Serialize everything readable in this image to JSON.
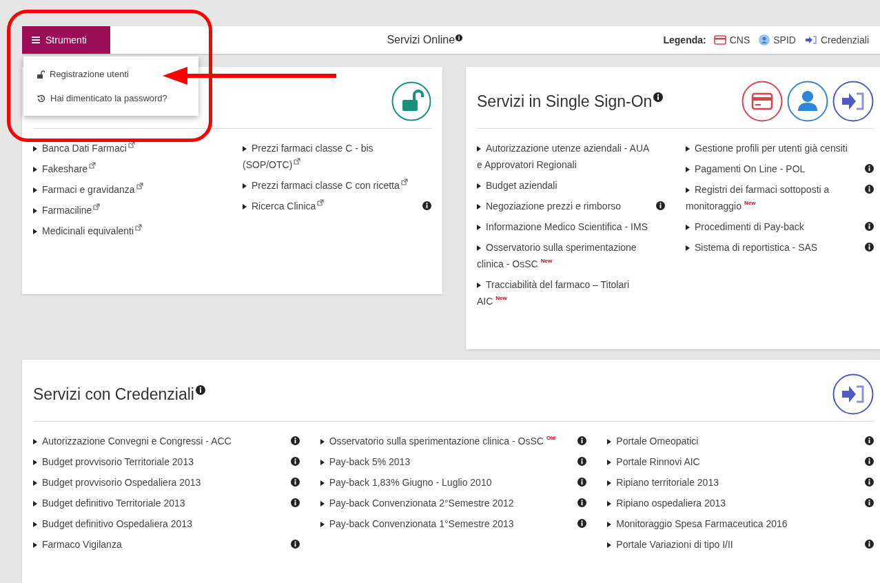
{
  "toolbar": {
    "menu_button": {
      "label": "Strumenti",
      "expanded": true
    },
    "title": "Servizi Online",
    "title_info": true,
    "legend": {
      "label": "Legenda:",
      "items": [
        {
          "kind": "cns",
          "label": "CNS"
        },
        {
          "kind": "spid",
          "label": "SPID"
        },
        {
          "kind": "credentials",
          "label": "Credenziali"
        }
      ]
    }
  },
  "menu": [
    {
      "kind": "lock",
      "label": "Registrazione utenti"
    },
    {
      "kind": "history",
      "label": "Hai dimenticato la password?"
    }
  ],
  "panels": [
    {
      "access": [
        {
          "kind": "open"
        }
      ],
      "columns": [
        [
          {
            "text": "Banca Dati Farmaci",
            "external": true,
            "info": false
          },
          {
            "text": "Fakeshare",
            "external": true,
            "info": false
          },
          {
            "text": "Farmaci e gravidanza",
            "external": true,
            "info": false
          },
          {
            "text": "Farmaciline",
            "external": true,
            "info": false
          },
          {
            "text": "Medicinali equivalenti",
            "external": true,
            "info": false
          }
        ],
        [
          {
            "text": "Prezzi farmaci classe C - bis (SOP/OTC)",
            "external": true,
            "info": false
          },
          {
            "text": "Prezzi farmaci classe C con ricetta",
            "external": true,
            "info": false
          },
          {
            "text": "Ricerca Clinica",
            "external": true,
            "info": true
          }
        ]
      ]
    },
    {
      "title": "Servizi in Single Sign-On",
      "title_info": true,
      "access": [
        {
          "kind": "cns"
        },
        {
          "kind": "spid"
        },
        {
          "kind": "credentials"
        }
      ],
      "columns": [
        [
          {
            "text": "Autorizzazione utenze aziendali - AUA e Approvatori Regionali",
            "info": false
          },
          {
            "text": "Budget aziendali",
            "info": false
          },
          {
            "text": "Negoziazione prezzi e rimborso",
            "info": true
          },
          {
            "text": "Informazione Medico Scientifica - IMS",
            "info": false
          },
          {
            "text": "Osservatorio sulla sperimentazione clinica - OsSC",
            "info": false,
            "badge": "New"
          },
          {
            "text": "Tracciabilità del farmaco – Titolari AIC",
            "info": false,
            "badge": "New"
          }
        ],
        [
          {
            "text": "Gestione profili per utenti già censiti",
            "info": false
          },
          {
            "text": "Pagamenti On Line - POL",
            "info": true
          },
          {
            "text": "Registri dei farmaci sottoposti a monitoraggio",
            "info": true,
            "badge": "New"
          },
          {
            "text": "Procedimenti di Pay-back",
            "info": true
          },
          {
            "text": "Sistema di reportistica - SAS",
            "info": true
          }
        ]
      ]
    },
    {
      "title": "Servizi con Credenziali",
      "title_info": true,
      "access": [
        {
          "kind": "credentials"
        }
      ],
      "columns": [
        [
          {
            "text": "Autorizzazione Convegni e Congressi - ACC",
            "info": true
          },
          {
            "text": "Budget provvisorio Territoriale 2013",
            "info": true
          },
          {
            "text": "Budget provvisorio Ospedaliera 2013",
            "info": true
          },
          {
            "text": "Budget definitivo Territoriale 2013",
            "info": true
          },
          {
            "text": "Budget definitivo Ospedaliera 2013",
            "info": false
          },
          {
            "text": "Farmaco Vigilanza",
            "info": true
          }
        ],
        [
          {
            "text": "Osservatorio sulla sperimentazione clinica - OsSC",
            "info": true,
            "badge": "Old"
          },
          {
            "text": "Pay-back 5% 2013",
            "info": true
          },
          {
            "text": "Pay-back 1,83% Giugno - Luglio 2010",
            "info": true
          },
          {
            "text": "Pay-back Convenzionata 2°Semestre 2012",
            "info": true
          },
          {
            "text": "Pay-back Convenzionata 1°Semestre 2013",
            "info": true
          }
        ],
        [
          {
            "text": "Portale Omeopatici",
            "info": true
          },
          {
            "text": "Portale Rinnovi AIC",
            "info": true
          },
          {
            "text": "Ripiano territoriale 2013",
            "info": true
          },
          {
            "text": "Ripiano ospedaliera 2013",
            "info": true
          },
          {
            "text": "Monitoraggio Spesa Farmaceutica 2016",
            "info": false
          },
          {
            "text": "Portale Variazioni di tipo I/II",
            "info": true
          }
        ]
      ]
    }
  ],
  "annotation": {
    "frame": true,
    "arrow": true
  }
}
